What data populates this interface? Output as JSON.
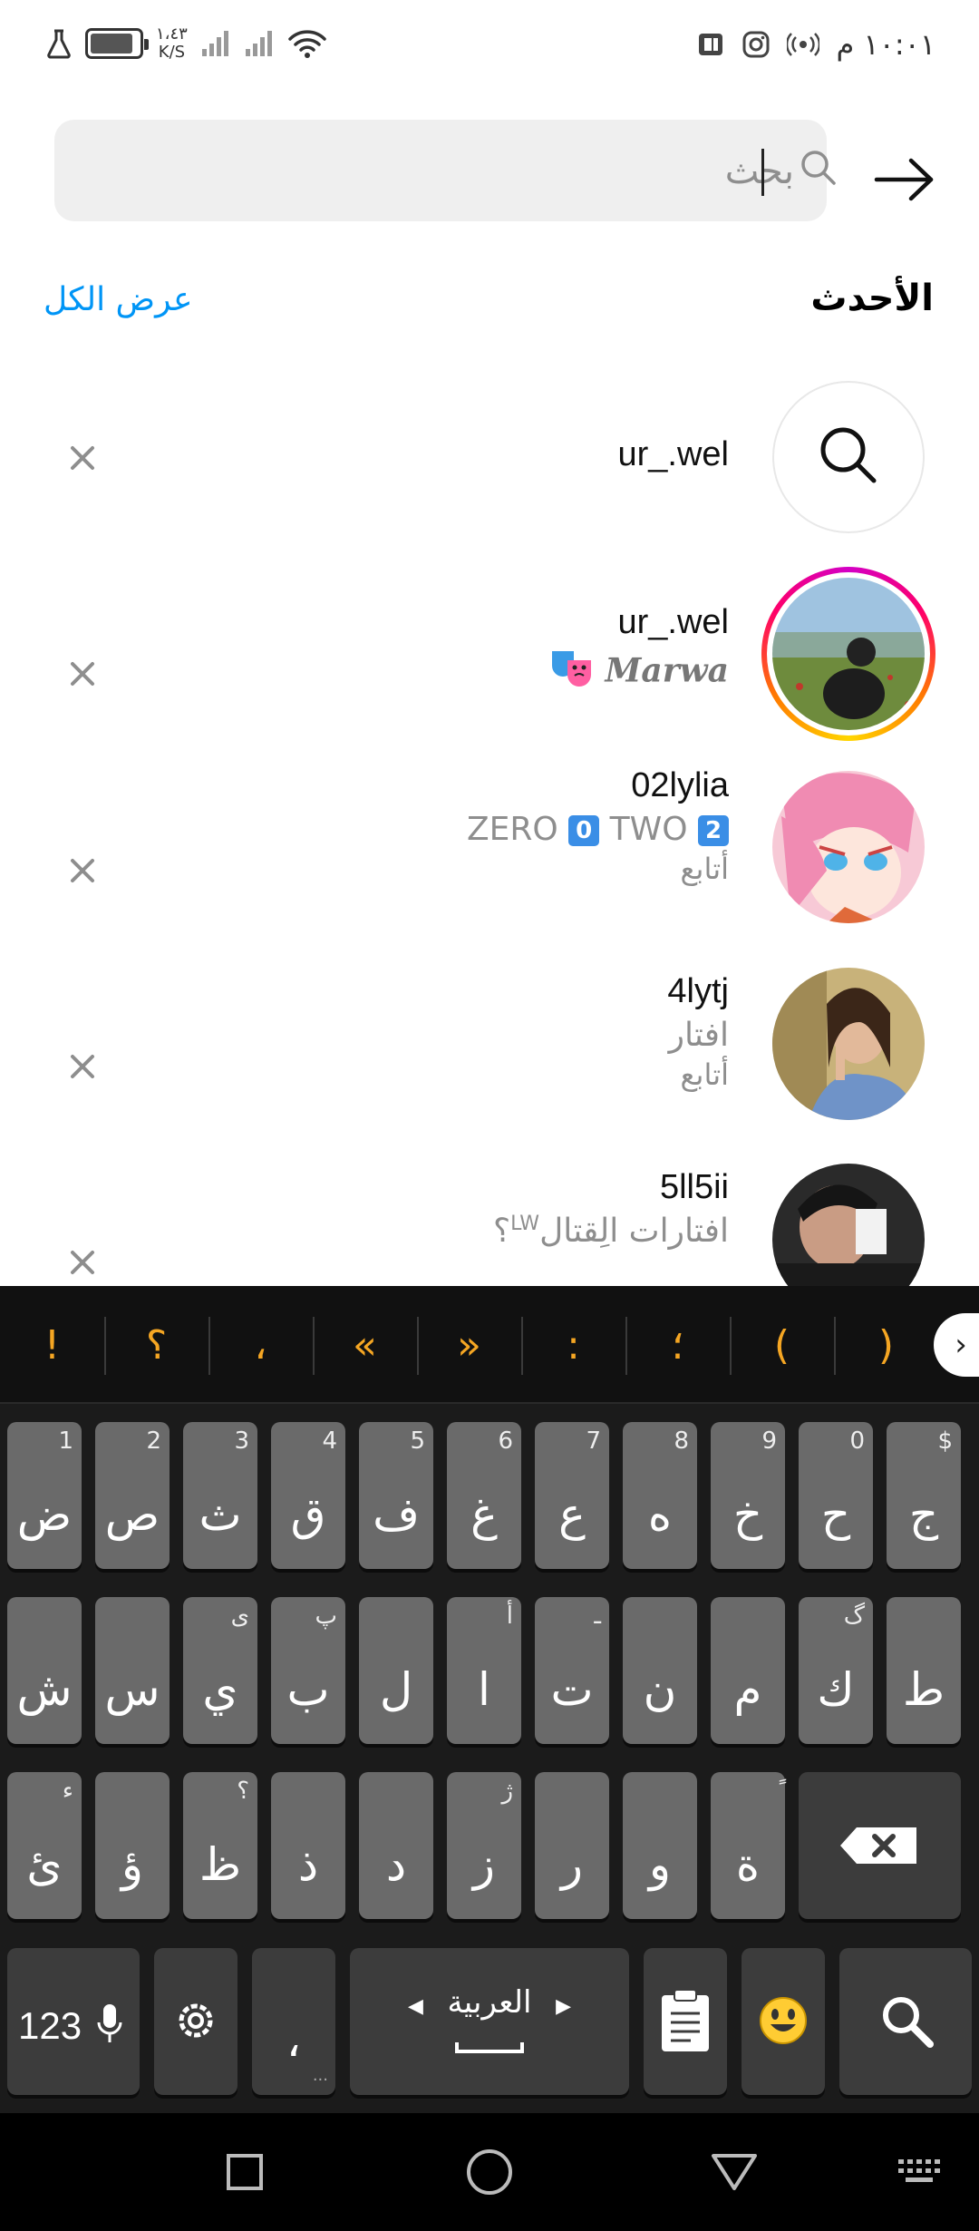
{
  "status_bar": {
    "time": "١٠:٠١ م",
    "net_speed_value": "١،٤٣",
    "net_speed_unit": "K/S"
  },
  "search": {
    "placeholder": "بحث",
    "back_icon": "arrow-right-icon",
    "search_icon": "search-icon"
  },
  "recent": {
    "title": "الأحدث",
    "see_all": "عرض الكل",
    "items": [
      {
        "kind": "search-term",
        "username": "ur_.wel"
      },
      {
        "kind": "account",
        "username": "ur_.wel",
        "subtitle": "Marwa",
        "story_ring": true
      },
      {
        "kind": "account",
        "username": "02lylia",
        "subtitle_parts": [
          "ZERO",
          "0",
          "TWO",
          "2"
        ],
        "note": "أتابع"
      },
      {
        "kind": "account",
        "username": "4lytj",
        "subtitle": "افتار",
        "note": "أتابع"
      },
      {
        "kind": "account",
        "username": "5ll5ii",
        "subtitle": "افتارات  الِقتال",
        "subtitle_sup": "LW",
        "subtitle_end": "؟"
      }
    ]
  },
  "keyboard": {
    "suggestions": [
      "!",
      "؟",
      "،",
      "«",
      "»",
      ":",
      "؛",
      "(",
      ")"
    ],
    "expand_icon": "chevron-right-icon",
    "row1": [
      {
        "main": "ض",
        "hint": "1"
      },
      {
        "main": "ص",
        "hint": "2"
      },
      {
        "main": "ث",
        "hint": "3"
      },
      {
        "main": "ق",
        "hint": "4"
      },
      {
        "main": "ف",
        "hint": "5"
      },
      {
        "main": "غ",
        "hint": "6"
      },
      {
        "main": "ع",
        "hint": "7"
      },
      {
        "main": "ه",
        "hint": "8"
      },
      {
        "main": "خ",
        "hint": "9"
      },
      {
        "main": "ح",
        "hint": "0"
      },
      {
        "main": "ج",
        "hint": "$"
      }
    ],
    "row2": [
      {
        "main": "ش",
        "hint": ""
      },
      {
        "main": "س",
        "hint": ""
      },
      {
        "main": "ي",
        "hint": "ى"
      },
      {
        "main": "ب",
        "hint": "پ"
      },
      {
        "main": "ل",
        "hint": ""
      },
      {
        "main": "ا",
        "hint": "أ"
      },
      {
        "main": "ت",
        "hint": "ـ"
      },
      {
        "main": "ن",
        "hint": ""
      },
      {
        "main": "م",
        "hint": ""
      },
      {
        "main": "ك",
        "hint": "گ"
      },
      {
        "main": "ط",
        "hint": ""
      }
    ],
    "row3": [
      {
        "main": "ئ",
        "hint": "ء"
      },
      {
        "main": "ؤ",
        "hint": ""
      },
      {
        "main": "ظ",
        "hint": "؟"
      },
      {
        "main": "ذ",
        "hint": ""
      },
      {
        "main": "د",
        "hint": ""
      },
      {
        "main": "ز",
        "hint": "ژ"
      },
      {
        "main": "ر",
        "hint": ""
      },
      {
        "main": "و",
        "hint": ""
      },
      {
        "main": "ة",
        "hint": "ً"
      }
    ],
    "numbers_label": "123",
    "comma": "،",
    "language": "العربية",
    "delete_icon": "backspace-icon",
    "settings_icon": "settings-icon",
    "clipboard_icon": "clipboard-icon",
    "emoji_icon": "smiley-icon",
    "search_key_icon": "search-icon"
  },
  "nav": {
    "recents_icon": "square-icon",
    "home_icon": "circle-icon",
    "back_icon": "triangle-back-icon",
    "keyboard_icon": "keyboard-icon"
  },
  "colors": {
    "accent": "#0095f6",
    "keyboard_accent": "#f5a623"
  }
}
